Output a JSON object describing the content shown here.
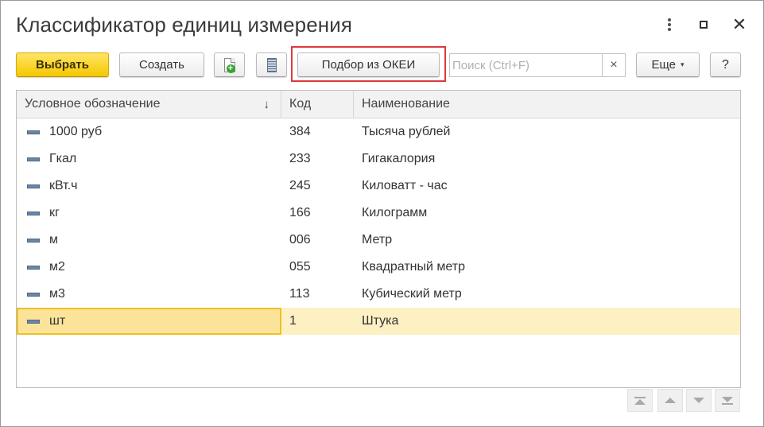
{
  "window": {
    "title": "Классификатор единиц измерения",
    "close_symbol": "✕"
  },
  "toolbar": {
    "select_label": "Выбрать",
    "create_label": "Создать",
    "okei_label": "Подбор из ОКЕИ",
    "search_placeholder": "Поиск (Ctrl+F)",
    "search_value": "",
    "search_clear_symbol": "×",
    "more_label": "Еще",
    "more_caret": "▾",
    "help_label": "?",
    "icons": [
      "document-add-icon",
      "list-icon"
    ]
  },
  "table": {
    "columns": [
      "Условное обозначение",
      "Код",
      "Наименование"
    ],
    "sort_indicator": "↓",
    "rows": [
      {
        "symbol": "1000 руб",
        "code": "384",
        "name": "Тысяча рублей"
      },
      {
        "symbol": "Гкал",
        "code": "233",
        "name": "Гигакалория"
      },
      {
        "symbol": "кВт.ч",
        "code": "245",
        "name": "Киловатт - час"
      },
      {
        "symbol": "кг",
        "code": "166",
        "name": "Килограмм"
      },
      {
        "symbol": "м",
        "code": "006",
        "name": "Метр"
      },
      {
        "symbol": "м2",
        "code": "055",
        "name": "Квадратный метр"
      },
      {
        "symbol": "м3",
        "code": "113",
        "name": "Кубический метр"
      },
      {
        "symbol": "шт",
        "code": "1",
        "name": "Штука",
        "selected": true
      }
    ]
  },
  "colors": {
    "primary_button": "#f5c800",
    "highlight_frame": "#e0393c",
    "selected_row": "#fdf1c4"
  }
}
